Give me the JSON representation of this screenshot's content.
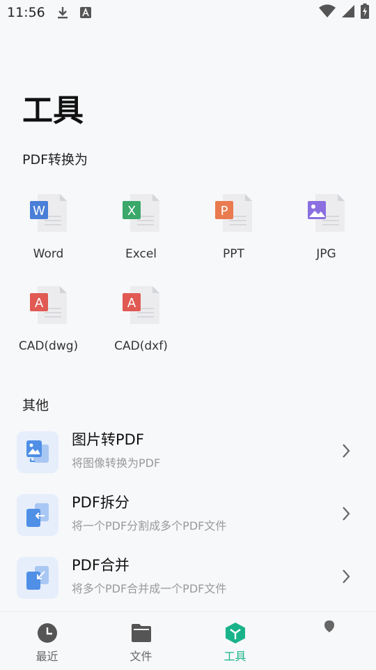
{
  "status_bar": {
    "time": "11:56",
    "icons": [
      "download-icon",
      "font-a-icon",
      "wifi-icon",
      "signal-icon",
      "battery-charging-icon"
    ]
  },
  "page": {
    "title": "工具"
  },
  "conversion_section": {
    "label": "PDF转换为",
    "items": [
      {
        "label": "Word",
        "badge": "W",
        "color": "#4a7fd8",
        "icon": "word-doc-icon"
      },
      {
        "label": "Excel",
        "badge": "X",
        "color": "#3aa86a",
        "icon": "excel-doc-icon"
      },
      {
        "label": "PPT",
        "badge": "P",
        "color": "#ea7a4f",
        "icon": "ppt-doc-icon"
      },
      {
        "label": "JPG",
        "badge": "",
        "color": "#8b6ee0",
        "icon": "jpg-image-icon"
      },
      {
        "label": "CAD(dwg)",
        "badge": "A",
        "color": "#e05a53",
        "icon": "cad-dwg-doc-icon"
      },
      {
        "label": "CAD(dxf)",
        "badge": "A",
        "color": "#e05a53",
        "icon": "cad-dxf-doc-icon"
      }
    ]
  },
  "other_section": {
    "label": "其他",
    "items": [
      {
        "title": "图片转PDF",
        "subtitle": "将图像转换为PDF",
        "icon": "image-to-pdf-icon"
      },
      {
        "title": "PDF拆分",
        "subtitle": "将一个PDF分割成多个PDF文件",
        "icon": "pdf-split-icon"
      },
      {
        "title": "PDF合并",
        "subtitle": "将多个PDF合并成一个PDF文件",
        "icon": "pdf-merge-icon"
      }
    ]
  },
  "tab_bar": {
    "accent": "#19b38a",
    "tabs": [
      {
        "label": "最近",
        "icon": "clock-icon",
        "active": false
      },
      {
        "label": "文件",
        "icon": "folder-icon",
        "active": false
      },
      {
        "label": "工具",
        "icon": "tools-cube-icon",
        "active": true
      },
      {
        "label": "",
        "icon": "profile-icon",
        "active": false
      }
    ]
  }
}
